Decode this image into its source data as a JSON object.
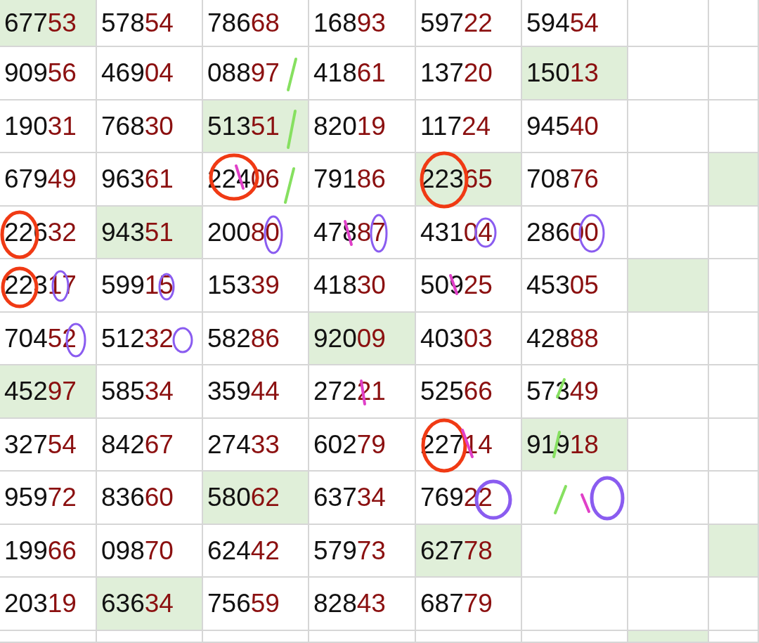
{
  "rows": [
    {
      "cells": [
        {
          "text": "67753",
          "highlighted": true
        },
        {
          "text": "57854",
          "highlighted": false
        },
        {
          "text": "78668",
          "highlighted": false
        },
        {
          "text": "16893",
          "highlighted": false
        },
        {
          "text": "59722",
          "highlighted": false
        },
        {
          "text": "59454",
          "highlighted": false
        },
        {
          "highlighted": false
        },
        {
          "highlighted": false
        }
      ]
    },
    {
      "cells": [
        {
          "text": "90956",
          "highlighted": false
        },
        {
          "text": "46904",
          "highlighted": false
        },
        {
          "text": "08897",
          "highlighted": false
        },
        {
          "text": "41861",
          "highlighted": false
        },
        {
          "text": "13720",
          "highlighted": false
        },
        {
          "text": "15013",
          "highlighted": true
        },
        {
          "highlighted": false
        },
        {
          "highlighted": false
        }
      ]
    },
    {
      "cells": [
        {
          "text": "19031",
          "highlighted": false
        },
        {
          "text": "76830",
          "highlighted": false
        },
        {
          "text": "51351",
          "highlighted": true
        },
        {
          "text": "82019",
          "highlighted": false
        },
        {
          "text": "11724",
          "highlighted": false
        },
        {
          "text": "94540",
          "highlighted": false
        },
        {
          "highlighted": false
        },
        {
          "highlighted": false
        }
      ]
    },
    {
      "cells": [
        {
          "text": "67949",
          "highlighted": false
        },
        {
          "text": "96361",
          "highlighted": false
        },
        {
          "text": "22406",
          "highlighted": false
        },
        {
          "text": "79186",
          "highlighted": false
        },
        {
          "text": "22365",
          "highlighted": true
        },
        {
          "text": "70876",
          "highlighted": false
        },
        {
          "highlighted": false
        },
        {
          "highlighted": true
        }
      ]
    },
    {
      "cells": [
        {
          "text": "22632",
          "highlighted": false
        },
        {
          "text": "94351",
          "highlighted": true
        },
        {
          "text": "20080",
          "highlighted": false
        },
        {
          "text": "47887",
          "highlighted": false
        },
        {
          "text": "43104",
          "highlighted": false
        },
        {
          "text": "28600",
          "highlighted": false
        },
        {
          "highlighted": false
        },
        {
          "highlighted": false
        }
      ]
    },
    {
      "cells": [
        {
          "text": "22317",
          "highlighted": false
        },
        {
          "text": "59915",
          "highlighted": false
        },
        {
          "text": "15339",
          "highlighted": false
        },
        {
          "text": "41830",
          "highlighted": false
        },
        {
          "text": "50925",
          "highlighted": false
        },
        {
          "text": "45305",
          "highlighted": false
        },
        {
          "highlighted": true
        },
        {
          "highlighted": false
        }
      ]
    },
    {
      "cells": [
        {
          "text": "70452",
          "highlighted": false
        },
        {
          "text": "51232",
          "highlighted": false
        },
        {
          "text": "58286",
          "highlighted": false
        },
        {
          "text": "92009",
          "highlighted": true
        },
        {
          "text": "40303",
          "highlighted": false
        },
        {
          "text": "42888",
          "highlighted": false
        },
        {
          "highlighted": false
        },
        {
          "highlighted": false
        }
      ]
    },
    {
      "cells": [
        {
          "text": "45297",
          "highlighted": true
        },
        {
          "text": "58534",
          "highlighted": false
        },
        {
          "text": "35944",
          "highlighted": false
        },
        {
          "text": "27221",
          "highlighted": false
        },
        {
          "text": "52566",
          "highlighted": false
        },
        {
          "text": "57349",
          "highlighted": false
        },
        {
          "highlighted": false
        },
        {
          "highlighted": false
        }
      ]
    },
    {
      "cells": [
        {
          "text": "32754",
          "highlighted": false
        },
        {
          "text": "84267",
          "highlighted": false
        },
        {
          "text": "27433",
          "highlighted": false
        },
        {
          "text": "60279",
          "highlighted": false
        },
        {
          "text": "22714",
          "highlighted": false
        },
        {
          "text": "91918",
          "highlighted": true
        },
        {
          "highlighted": false
        },
        {
          "highlighted": false
        }
      ]
    },
    {
      "cells": [
        {
          "text": "95972",
          "highlighted": false
        },
        {
          "text": "83660",
          "highlighted": false
        },
        {
          "text": "58062",
          "highlighted": true
        },
        {
          "text": "63734",
          "highlighted": false
        },
        {
          "text": "76922",
          "highlighted": false
        },
        {
          "highlighted": false
        },
        {
          "highlighted": false
        },
        {
          "highlighted": false
        }
      ]
    },
    {
      "cells": [
        {
          "text": "19966",
          "highlighted": false
        },
        {
          "text": "09870",
          "highlighted": false
        },
        {
          "text": "62442",
          "highlighted": false
        },
        {
          "text": "57973",
          "highlighted": false
        },
        {
          "text": "62778",
          "highlighted": true
        },
        {
          "highlighted": false
        },
        {
          "highlighted": false
        },
        {
          "highlighted": true
        }
      ]
    },
    {
      "cells": [
        {
          "text": "20319",
          "highlighted": false
        },
        {
          "text": "63634",
          "highlighted": true
        },
        {
          "text": "75659",
          "highlighted": false
        },
        {
          "text": "82843",
          "highlighted": false
        },
        {
          "text": "68779",
          "highlighted": false
        },
        {
          "highlighted": false
        },
        {
          "highlighted": false
        },
        {
          "highlighted": false
        }
      ]
    },
    {
      "cells": [
        {
          "highlighted": false
        },
        {
          "highlighted": false
        },
        {
          "highlighted": false
        },
        {
          "highlighted": false
        },
        {
          "highlighted": false
        },
        {
          "highlighted": false
        },
        {
          "highlighted": true
        },
        {
          "highlighted": false
        }
      ]
    }
  ],
  "annotations": [
    {
      "kind": "circle",
      "color": "#f03a14"
    },
    {
      "kind": "circle",
      "color": "#f03a14"
    },
    {
      "kind": "circle",
      "color": "#f03a14"
    },
    {
      "kind": "circle",
      "color": "#f03a14"
    },
    {
      "kind": "circle",
      "color": "#f03a14"
    },
    {
      "kind": "circle",
      "color": "#8a5cf0"
    },
    {
      "kind": "circle",
      "color": "#8a5cf0"
    },
    {
      "kind": "circle",
      "color": "#8a5cf0"
    },
    {
      "kind": "circle",
      "color": "#8a5cf0"
    },
    {
      "kind": "circle",
      "color": "#8a5cf0"
    },
    {
      "kind": "circle",
      "color": "#8a5cf0"
    },
    {
      "kind": "circle",
      "color": "#8a5cf0"
    },
    {
      "kind": "circle",
      "color": "#8a5cf0"
    },
    {
      "kind": "circle",
      "color": "#8a5cf0"
    },
    {
      "kind": "circle",
      "color": "#8a5cf0"
    },
    {
      "kind": "stroke",
      "color": "#86e060"
    },
    {
      "kind": "stroke",
      "color": "#86e060"
    },
    {
      "kind": "stroke",
      "color": "#86e060"
    },
    {
      "kind": "stroke",
      "color": "#86e060"
    },
    {
      "kind": "stroke",
      "color": "#86e060"
    },
    {
      "kind": "stroke",
      "color": "#86e060"
    },
    {
      "kind": "stroke",
      "color": "#e040c8"
    },
    {
      "kind": "stroke",
      "color": "#e040c8"
    },
    {
      "kind": "stroke",
      "color": "#e040c8"
    },
    {
      "kind": "stroke",
      "color": "#e040c8"
    },
    {
      "kind": "stroke",
      "color": "#e040c8"
    },
    {
      "kind": "stroke",
      "color": "#e040c8"
    }
  ]
}
